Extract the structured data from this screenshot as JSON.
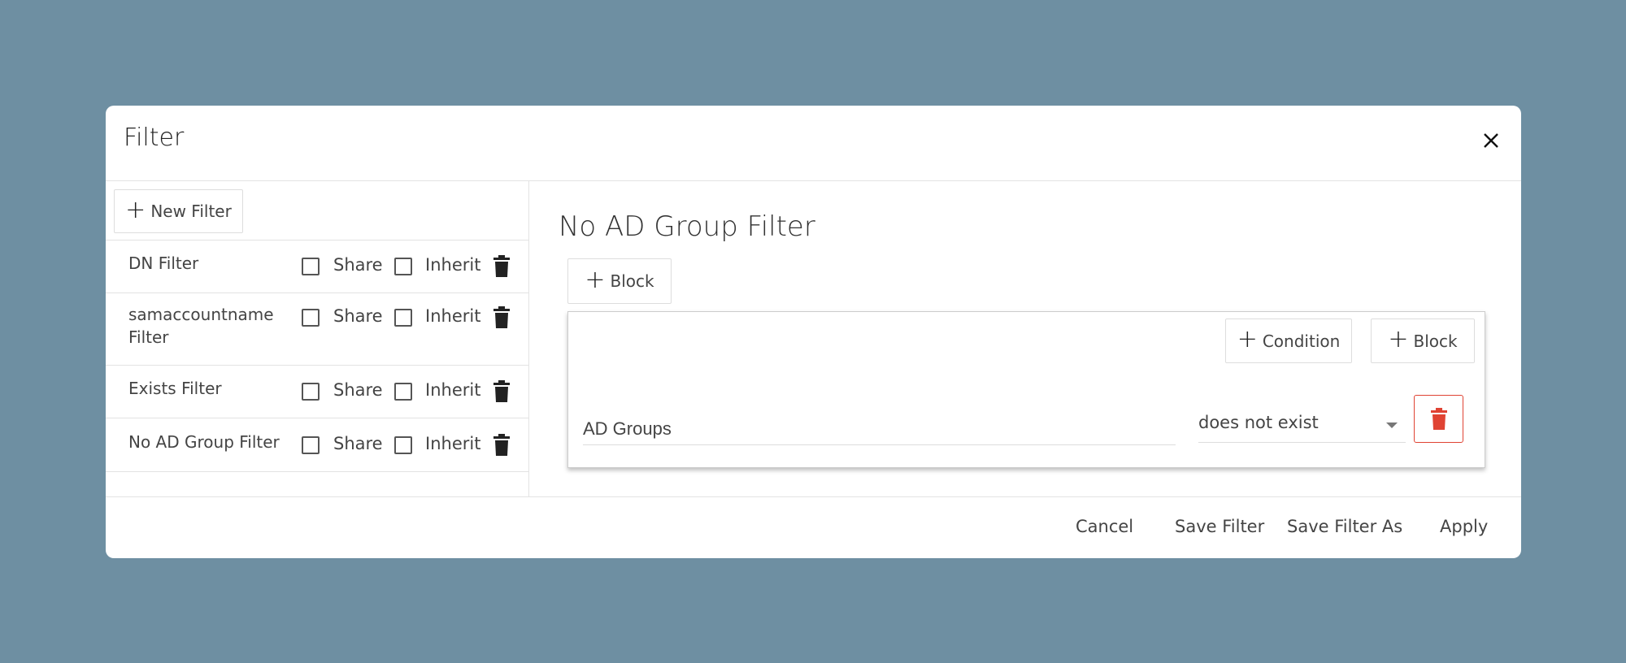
{
  "dialog": {
    "title": "Filter",
    "close_icon": "close-icon"
  },
  "left_panel": {
    "new_filter_label": "New Filter",
    "filters": [
      {
        "name": "DN Filter",
        "share_label": "Share",
        "share_checked": false,
        "inherit_label": "Inherit",
        "inherit_checked": false
      },
      {
        "name": "samaccountname Filter",
        "share_label": "Share",
        "share_checked": false,
        "inherit_label": "Inherit",
        "inherit_checked": false
      },
      {
        "name": "Exists Filter",
        "share_label": "Share",
        "share_checked": false,
        "inherit_label": "Inherit",
        "inherit_checked": false
      },
      {
        "name": "No AD Group Filter",
        "share_label": "Share",
        "share_checked": false,
        "inherit_label": "Inherit",
        "inherit_checked": false
      }
    ]
  },
  "right_panel": {
    "title": "No AD Group Filter",
    "add_block_label": "Block",
    "block": {
      "add_condition_label": "Condition",
      "add_block_label": "Block",
      "condition": {
        "field_value": "AD Groups",
        "operator_value": "does not exist"
      }
    }
  },
  "footer": {
    "cancel_label": "Cancel",
    "save_filter_label": "Save Filter",
    "save_filter_as_label": "Save Filter As",
    "apply_label": "Apply"
  },
  "colors": {
    "backdrop": "#6e8fa2",
    "danger": "#e04333"
  }
}
